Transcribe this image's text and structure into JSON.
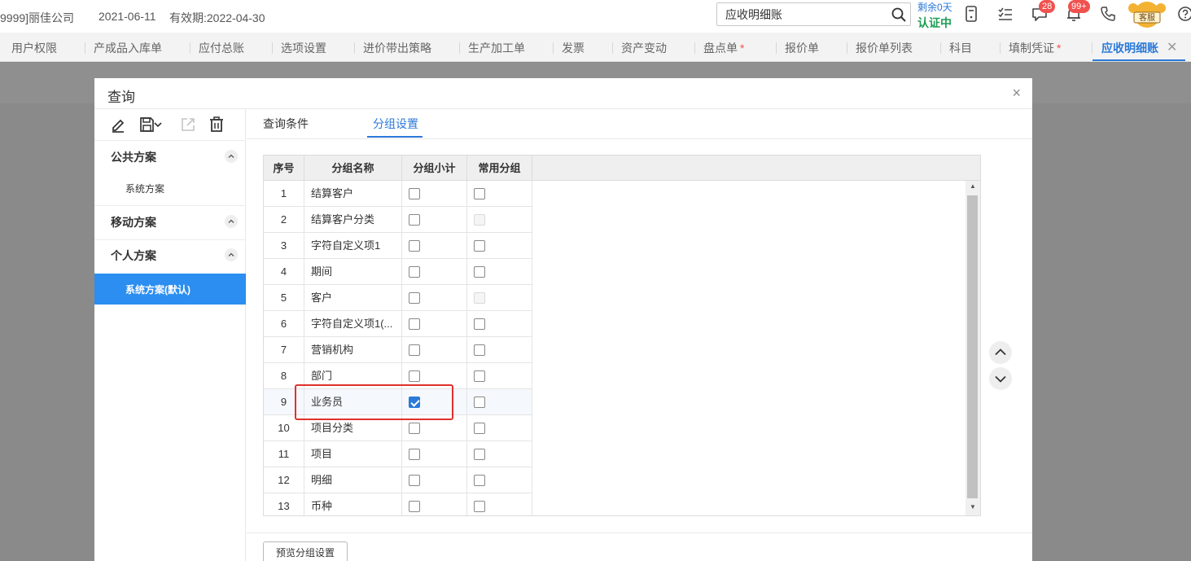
{
  "topbar": {
    "company": "9999]丽佳公司",
    "date": "2021-06-11",
    "validity": "有效期:2022-04-30",
    "search_value": "应收明细账",
    "remain": "剩余0天",
    "cert_status": "认证中",
    "msg_badge": "28",
    "notify_badge": "99+",
    "avatar_text": "客服",
    "icons": [
      "calculator-icon",
      "checklist-icon",
      "message-icon",
      "bell-icon",
      "phone-icon",
      "help-icon"
    ]
  },
  "tabs": [
    {
      "label": "用户权限"
    },
    {
      "label": "产成品入库单"
    },
    {
      "label": "应付总账"
    },
    {
      "label": "选项设置"
    },
    {
      "label": "进价带出策略"
    },
    {
      "label": "生产加工单"
    },
    {
      "label": "发票"
    },
    {
      "label": "资产变动"
    },
    {
      "label": "盘点单",
      "star": "*"
    },
    {
      "label": "报价单"
    },
    {
      "label": "报价单列表"
    },
    {
      "label": "科目"
    },
    {
      "label": "填制凭证",
      "star": "*"
    },
    {
      "label": "应收明细账",
      "active": true
    }
  ],
  "dialog": {
    "title": "查询",
    "close": "×",
    "left": {
      "groups": [
        {
          "title": "公共方案",
          "plans": [
            "系统方案"
          ]
        },
        {
          "title": "移动方案",
          "plans": []
        },
        {
          "title": "个人方案",
          "plans": [
            "系统方案(默认)"
          ]
        }
      ]
    },
    "right_tabs": [
      "查询条件",
      "分组设置"
    ],
    "grid": {
      "headers": [
        "序号",
        "分组名称",
        "分组小计",
        "常用分组"
      ],
      "rows": [
        {
          "no": "1",
          "name": "结算客户",
          "subtotal": false,
          "common": false,
          "common_disabled": false
        },
        {
          "no": "2",
          "name": "结算客户分类",
          "subtotal": false,
          "common": false,
          "common_disabled": true
        },
        {
          "no": "3",
          "name": "字符自定义项1",
          "subtotal": false,
          "common": false,
          "common_disabled": false
        },
        {
          "no": "4",
          "name": "期间",
          "subtotal": false,
          "common": false,
          "common_disabled": false
        },
        {
          "no": "5",
          "name": "客户",
          "subtotal": false,
          "common": false,
          "common_disabled": true
        },
        {
          "no": "6",
          "name": "字符自定义项1(...",
          "subtotal": false,
          "common": false,
          "common_disabled": false
        },
        {
          "no": "7",
          "name": "营销机构",
          "subtotal": false,
          "common": false,
          "common_disabled": false
        },
        {
          "no": "8",
          "name": "部门",
          "subtotal": false,
          "common": false,
          "common_disabled": false
        },
        {
          "no": "9",
          "name": "业务员",
          "subtotal": true,
          "common": false,
          "common_disabled": false,
          "selected": true
        },
        {
          "no": "10",
          "name": "项目分类",
          "subtotal": false,
          "common": false,
          "common_disabled": false
        },
        {
          "no": "11",
          "name": "项目",
          "subtotal": false,
          "common": false,
          "common_disabled": false
        },
        {
          "no": "12",
          "name": "明细",
          "subtotal": false,
          "common": false,
          "common_disabled": false
        },
        {
          "no": "13",
          "name": "币种",
          "subtotal": false,
          "common": false,
          "common_disabled": false
        }
      ]
    },
    "preview_button": "预览分组设置"
  },
  "colors": {
    "accent": "#2b79d8",
    "active_plan_bg": "#2b8ef0",
    "badge": "#f0524f",
    "cert_green": "#1f9d55",
    "highlight_red": "#e0312c"
  }
}
